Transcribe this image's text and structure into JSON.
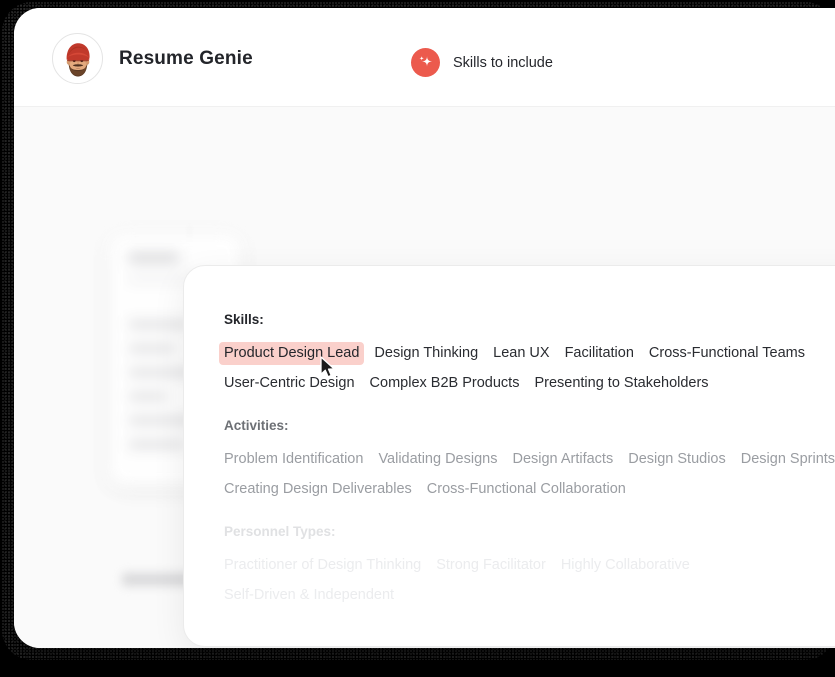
{
  "window": {
    "app_title": "Resume Genie",
    "avatar_icon": "avatar-man-with-turban",
    "header_action": {
      "icon": "sparkle-icon",
      "label": "Skills to include",
      "accent_color": "#ec5a4d"
    }
  },
  "panel": {
    "groups": [
      {
        "id": "skills",
        "label": "Skills:",
        "items": [
          {
            "text": "Product Design Lead",
            "selected": true
          },
          {
            "text": "Design Thinking",
            "selected": false
          },
          {
            "text": "Lean UX",
            "selected": false
          },
          {
            "text": "Facilitation",
            "selected": false
          },
          {
            "text": "Cross-Functional Teams",
            "selected": false
          },
          {
            "text": "User-Centric Design",
            "selected": false
          },
          {
            "text": "Complex B2B Products",
            "selected": false
          },
          {
            "text": "Presenting to Stakeholders",
            "selected": false
          }
        ]
      },
      {
        "id": "activities",
        "label": "Activities:",
        "items": [
          {
            "text": "Problem Identification",
            "selected": false
          },
          {
            "text": "Validating Designs",
            "selected": false
          },
          {
            "text": "Design Artifacts",
            "selected": false
          },
          {
            "text": "Design Studios",
            "selected": false
          },
          {
            "text": "Design Sprints",
            "selected": false
          },
          {
            "text": "Creating Design Deliverables",
            "selected": false
          },
          {
            "text": "Cross-Functional Collaboration",
            "selected": false
          }
        ]
      },
      {
        "id": "personnel",
        "label": "Personnel Types:",
        "items": [
          {
            "text": "Practitioner of Design Thinking",
            "selected": false
          },
          {
            "text": "Strong Facilitator",
            "selected": false
          },
          {
            "text": "Highly Collaborative",
            "selected": false
          },
          {
            "text": "Self-Driven & Independent",
            "selected": false
          }
        ]
      }
    ],
    "selected_chip_color": "#fad0cb"
  },
  "cursor": {
    "icon": "mouse-arrow-cursor"
  }
}
